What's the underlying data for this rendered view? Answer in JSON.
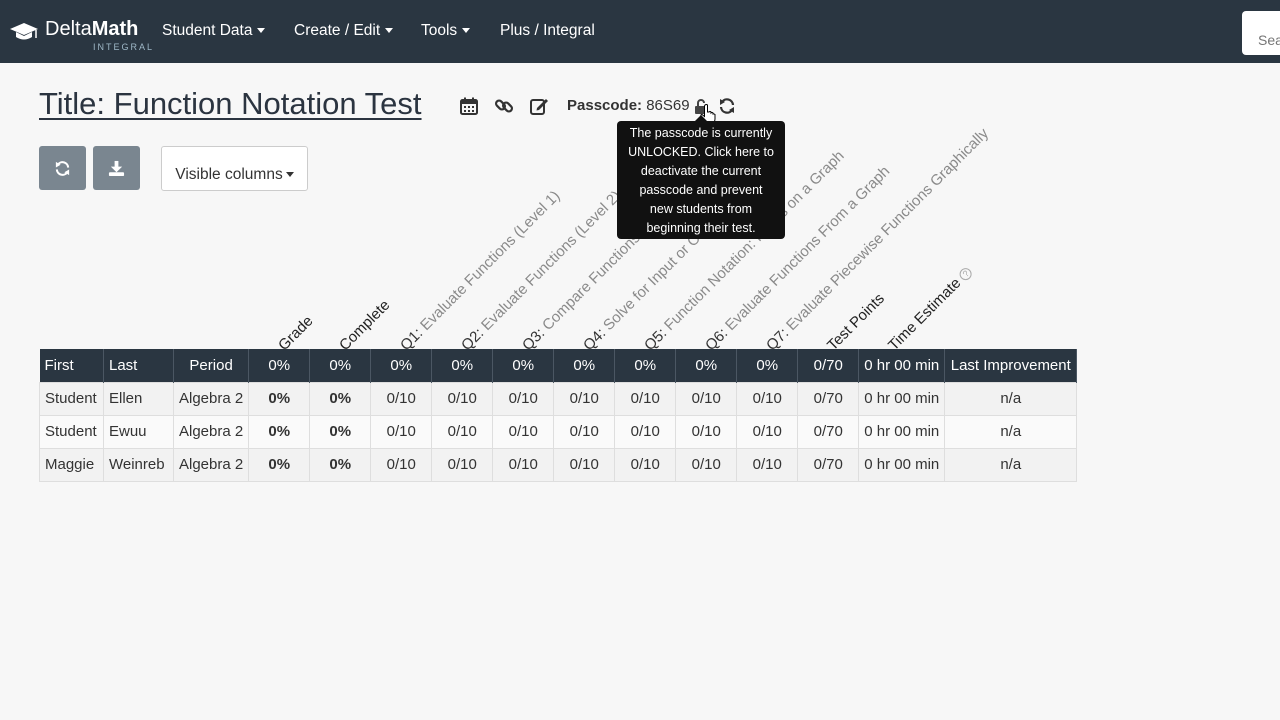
{
  "nav": {
    "brand": "Delta",
    "brand_b": "Math",
    "brand_sub": "INTEGRAL",
    "items": [
      "Student Data",
      "Create / Edit",
      "Tools",
      "Plus / Integral"
    ],
    "search_placeholder": "Sea"
  },
  "page": {
    "title": "Title: Function Notation Test",
    "passcode_label": "Passcode:",
    "passcode_value": "86S69"
  },
  "tooltip": {
    "lines": [
      "The passcode is currently",
      "UNLOCKED. Click here to",
      "deactivate the current",
      "passcode and prevent",
      "new students from",
      "beginning their test."
    ]
  },
  "toolbar": {
    "visible_columns": "Visible columns"
  },
  "rotated_headers": {
    "grade": "Grade",
    "complete": "Complete",
    "q1_num": "Q1:",
    "q1": "Evaluate Functions (Level 1)",
    "q2_num": "Q2:",
    "q2": "Evaluate Functions (Level 2)",
    "q3_num": "Q3:",
    "q3": "Compare Functions",
    "q4_num": "Q4:",
    "q4": "Solve for Input or Output",
    "q5_num": "Q5:",
    "q5": "Function Notation: Points on a Graph",
    "q6_num": "Q6:",
    "q6": "Evaluate Functions From a Graph",
    "q7_num": "Q7:",
    "q7": "Evaluate Piecewise Functions Graphically",
    "test_points": "Test Points",
    "time_estimate": "Time Estimate"
  },
  "table": {
    "header": [
      "First",
      "Last",
      "Period",
      "0%",
      "0%",
      "0%",
      "0%",
      "0%",
      "0%",
      "0%",
      "0%",
      "0%",
      "0/70",
      "0 hr 00 min",
      "Last Improvement"
    ],
    "rows": [
      [
        "Student",
        "Ellen",
        "Algebra 2",
        "0%",
        "0%",
        "0/10",
        "0/10",
        "0/10",
        "0/10",
        "0/10",
        "0/10",
        "0/10",
        "0/70",
        "0 hr 00 min",
        "n/a"
      ],
      [
        "Student",
        "Ewuu",
        "Algebra 2",
        "0%",
        "0%",
        "0/10",
        "0/10",
        "0/10",
        "0/10",
        "0/10",
        "0/10",
        "0/10",
        "0/70",
        "0 hr 00 min",
        "n/a"
      ],
      [
        "Maggie",
        "Weinreb",
        "Algebra 2",
        "0%",
        "0%",
        "0/10",
        "0/10",
        "0/10",
        "0/10",
        "0/10",
        "0/10",
        "0/10",
        "0/70",
        "0 hr 00 min",
        "n/a"
      ]
    ]
  },
  "colors": {
    "navbar": "#2a3641",
    "button_gray": "#7a8690",
    "tooltip": "#111111"
  }
}
